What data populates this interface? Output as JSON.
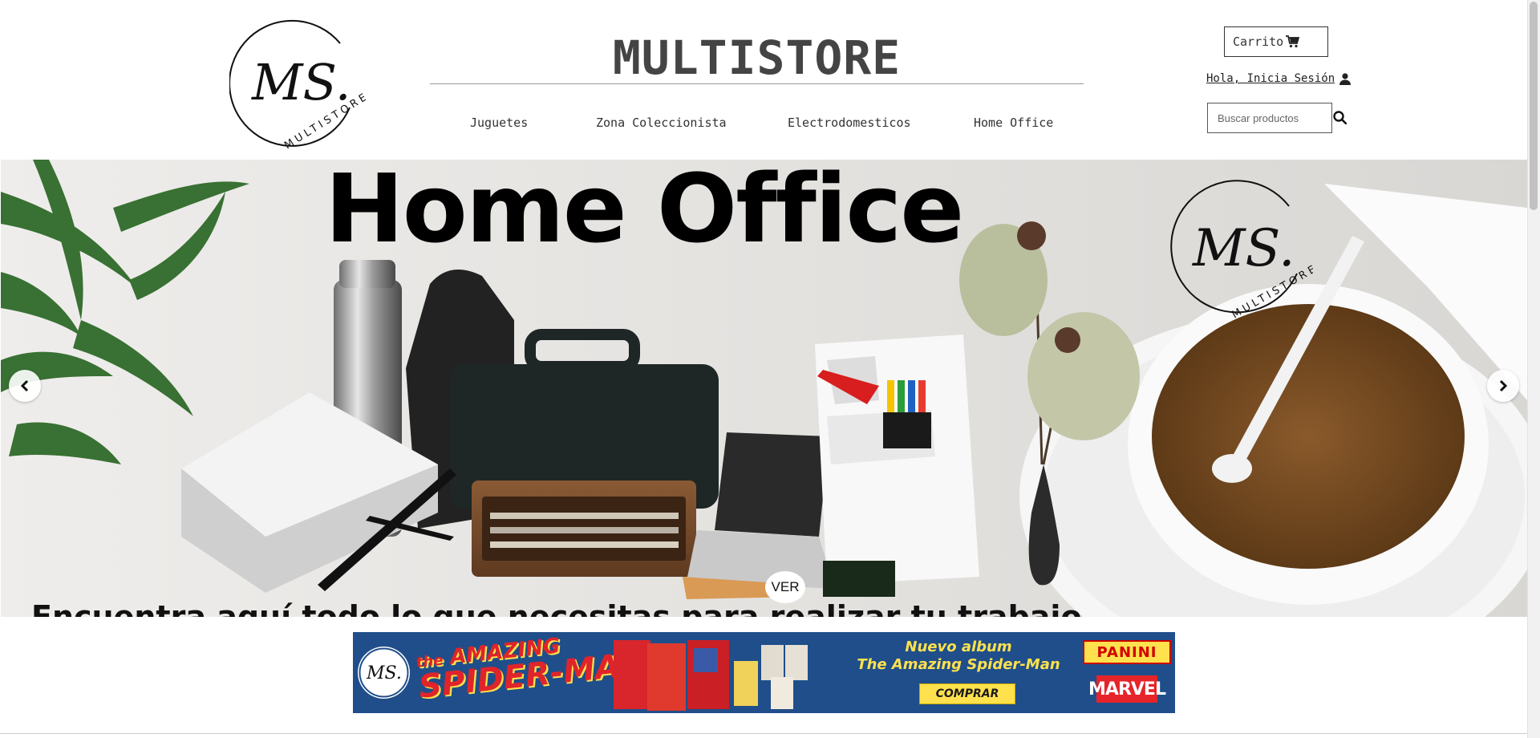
{
  "header": {
    "logo_initials": "MS.",
    "logo_ring_text": "MULTISTORE",
    "title": "MULTISTORE",
    "nav": [
      "Juguetes",
      "Zona Coleccionista",
      "Electrodomesticos",
      "Home Office"
    ],
    "cart_label": "Carrito",
    "login_label": "Hola, Inicia Sesión",
    "search_placeholder": "Buscar productos"
  },
  "hero": {
    "title": "Home Office",
    "caption": "Encuentra aquí todo lo que necesitas para realizar tu trabajo",
    "ver_label": "VER"
  },
  "banner": {
    "line1": "the",
    "line2": "AMAZING",
    "line3": "SPIDER-MAN",
    "copy_line1": "Nuevo album",
    "copy_line2": "The Amazing Spider-Man",
    "buy_label": "COMPRAR",
    "brand1": "PANINI",
    "brand2": "MARVEL"
  },
  "colors": {
    "banner_blue": "#1f4e8a",
    "banner_red": "#e0242a",
    "banner_yellow": "#ffe14d"
  }
}
